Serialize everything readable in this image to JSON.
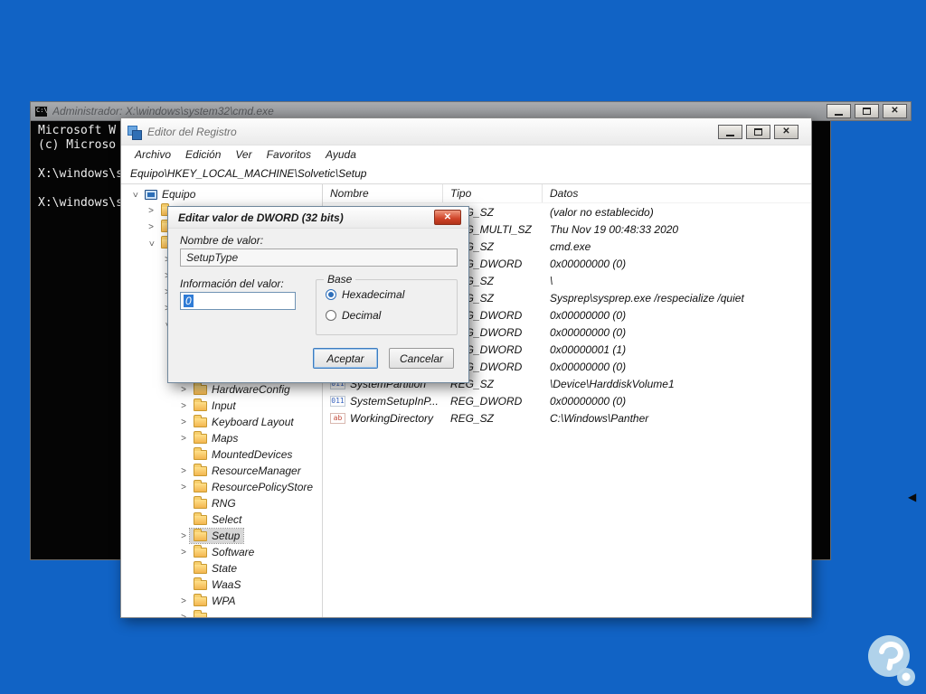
{
  "colors": {
    "desktop_bg": "#1163c5",
    "selection_blue": "#2f7cd6",
    "close_button_red": "#d0482e",
    "folder_yellow": "#f3b64f"
  },
  "icons": {
    "close": "✕",
    "chevron": ">",
    "arrow_left": "◀",
    "string_value": "ab",
    "dword_value": "011"
  },
  "cmd": {
    "title": "Administrador: X:\\windows\\system32\\cmd.exe",
    "lines": [
      "Microsoft W",
      "(c) Microso",
      "",
      "X:\\windows\\s",
      "",
      "X:\\windows\\s"
    ]
  },
  "regedit": {
    "title": "Editor del Registro",
    "menus": [
      "Archivo",
      "Edición",
      "Ver",
      "Favoritos",
      "Ayuda"
    ],
    "address": "Equipo\\HKEY_LOCAL_MACHINE\\Solvetic\\Setup",
    "tree": {
      "root": "Equipo",
      "collapsed_rows": [
        {
          "level": 1,
          "expanded": false
        },
        {
          "level": 1,
          "expanded": false
        },
        {
          "level": 1,
          "expanded": true
        },
        {
          "level": 2,
          "expanded": false
        },
        {
          "level": 2,
          "expanded": false
        },
        {
          "level": 2,
          "expanded": false
        },
        {
          "level": 2,
          "expanded": false
        },
        {
          "level": 2,
          "expanded": true
        },
        {
          "level": 3,
          "expanded": false
        },
        {
          "level": 3,
          "expanded": false
        },
        {
          "level": 3,
          "expanded": false
        }
      ],
      "items": [
        {
          "label": "HardwareConfig",
          "chevron": true,
          "selected": false
        },
        {
          "label": "Input",
          "chevron": true,
          "selected": false
        },
        {
          "label": "Keyboard Layout",
          "chevron": true,
          "selected": false
        },
        {
          "label": "Maps",
          "chevron": true,
          "selected": false
        },
        {
          "label": "MountedDevices",
          "chevron": false,
          "selected": false
        },
        {
          "label": "ResourceManager",
          "chevron": true,
          "selected": false
        },
        {
          "label": "ResourcePolicyStore",
          "chevron": true,
          "selected": false
        },
        {
          "label": "RNG",
          "chevron": false,
          "selected": false
        },
        {
          "label": "Select",
          "chevron": false,
          "selected": false
        },
        {
          "label": "Setup",
          "chevron": true,
          "selected": true
        },
        {
          "label": "Software",
          "chevron": true,
          "selected": false
        },
        {
          "label": "State",
          "chevron": false,
          "selected": false
        },
        {
          "label": "WaaS",
          "chevron": false,
          "selected": false
        },
        {
          "label": "WPA",
          "chevron": true,
          "selected": false
        },
        {
          "label": "",
          "chevron": true,
          "selected": false
        }
      ]
    },
    "list": {
      "columns": [
        "Nombre",
        "Tipo",
        "Datos"
      ],
      "rows": [
        {
          "name": "",
          "icon": "ab",
          "type": "REG_SZ",
          "data": "(valor no establecido)"
        },
        {
          "name": "",
          "icon": "ab",
          "type": "REG_MULTI_SZ",
          "data": "Thu Nov 19 00:48:33 2020"
        },
        {
          "name": "",
          "icon": "ab",
          "type": "REG_SZ",
          "data": "cmd.exe"
        },
        {
          "name": "",
          "icon": "bin",
          "type": "REG_DWORD",
          "data": "0x00000000 (0)"
        },
        {
          "name": "",
          "icon": "ab",
          "type": "REG_SZ",
          "data": "\\"
        },
        {
          "name": "",
          "icon": "ab",
          "type": "REG_SZ",
          "data": "Sysprep\\sysprep.exe /respecialize /quiet"
        },
        {
          "name": "",
          "icon": "bin",
          "type": "REG_DWORD",
          "data": "0x00000000 (0)"
        },
        {
          "name": "",
          "icon": "bin",
          "type": "REG_DWORD",
          "data": "0x00000000 (0)"
        },
        {
          "name": "",
          "icon": "bin",
          "type": "REG_DWORD",
          "data": "0x00000001 (1)"
        },
        {
          "name": "",
          "icon": "bin",
          "type": "REG_DWORD",
          "data": "0x00000000 (0)"
        },
        {
          "name": "SystemPartition",
          "icon": "bin",
          "type": "REG_SZ",
          "data": "\\Device\\HarddiskVolume1"
        },
        {
          "name": "SystemSetupInP...",
          "icon": "bin",
          "type": "REG_DWORD",
          "data": "0x00000000 (0)"
        },
        {
          "name": "WorkingDirectory",
          "icon": "ab",
          "type": "REG_SZ",
          "data": "C:\\Windows\\Panther"
        }
      ]
    }
  },
  "dialog": {
    "title": "Editar valor de DWORD (32 bits)",
    "name_label": "Nombre de valor:",
    "name_value": "SetupType",
    "value_label": "Información del valor:",
    "value": "0",
    "base": {
      "label": "Base",
      "options": [
        {
          "label": "Hexadecimal",
          "checked": true
        },
        {
          "label": "Decimal",
          "checked": false
        }
      ]
    },
    "ok_label": "Aceptar",
    "cancel_label": "Cancelar"
  }
}
